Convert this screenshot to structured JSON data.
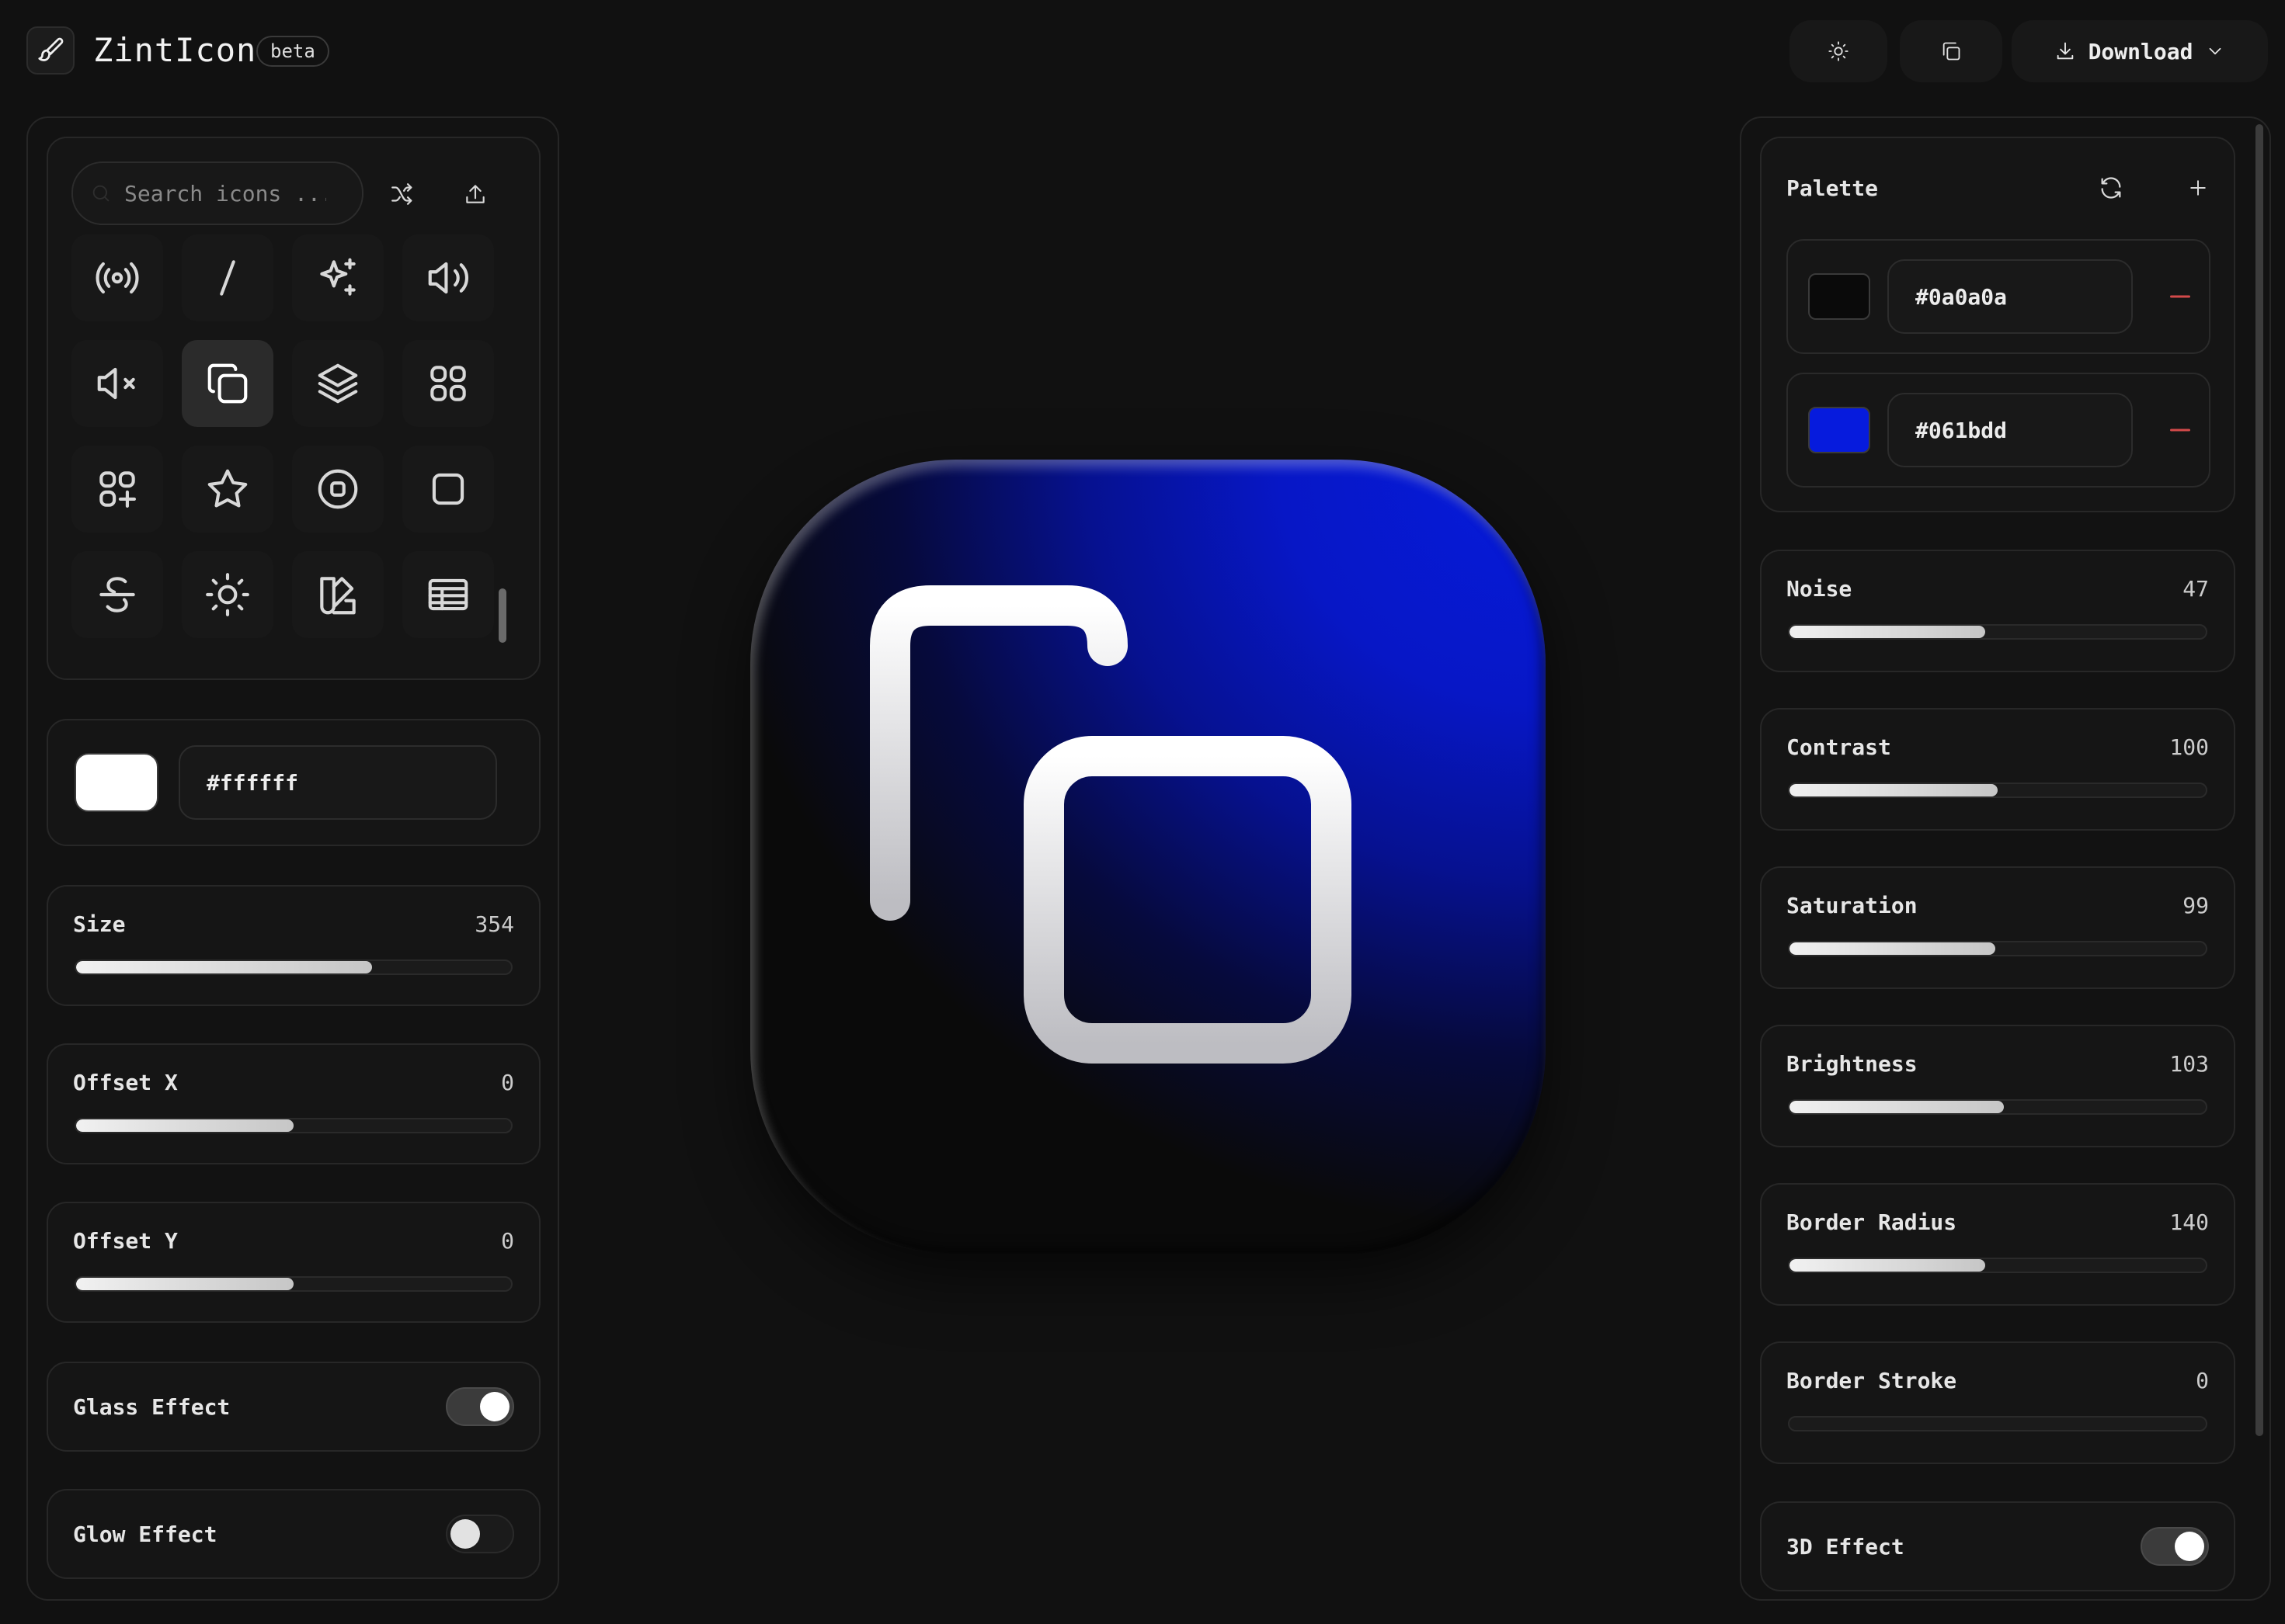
{
  "app": {
    "title": "ZintIcon",
    "badge": "beta"
  },
  "toolbar": {
    "download_label": "Download"
  },
  "icon_picker": {
    "search_placeholder": "Search icons ...",
    "icons": [
      "broadcast-icon",
      "slash-icon",
      "sparkles-icon",
      "volume-icon",
      "volume-mute-icon",
      "copy-icon",
      "layers-icon",
      "grid-icon",
      "grid-plus-icon",
      "star-icon",
      "stop-circle-icon",
      "square-icon",
      "strikethrough-icon",
      "sun-icon",
      "swatch-book-icon",
      "table-icon"
    ],
    "selected": "copy-icon"
  },
  "icon_color": {
    "hex": "#ffffff"
  },
  "left_sliders": [
    {
      "label": "Size",
      "value": "354",
      "fill": 0.68
    },
    {
      "label": "Offset X",
      "value": "0",
      "fill": 0.5
    },
    {
      "label": "Offset Y",
      "value": "0",
      "fill": 0.5
    }
  ],
  "left_toggles": [
    {
      "label": "Glass Effect",
      "on": true
    },
    {
      "label": "Glow Effect",
      "on": false
    }
  ],
  "palette": {
    "title": "Palette",
    "colors": [
      {
        "hex": "#0a0a0a"
      },
      {
        "hex": "#061bdd"
      }
    ]
  },
  "right_sliders": [
    {
      "label": "Noise",
      "value": "47",
      "fill": 0.47
    },
    {
      "label": "Contrast",
      "value": "100",
      "fill": 0.5
    },
    {
      "label": "Saturation",
      "value": "99",
      "fill": 0.495
    },
    {
      "label": "Brightness",
      "value": "103",
      "fill": 0.515
    },
    {
      "label": "Border Radius",
      "value": "140",
      "fill": 0.47
    },
    {
      "label": "Border Stroke",
      "value": "0",
      "fill": 0
    }
  ],
  "right_toggles": [
    {
      "label": "3D Effect",
      "on": true
    }
  ],
  "colors": {
    "background": "#111111",
    "accent_blue": "#061bdd",
    "dark": "#0a0a0a",
    "remove": "#d34a4a"
  }
}
